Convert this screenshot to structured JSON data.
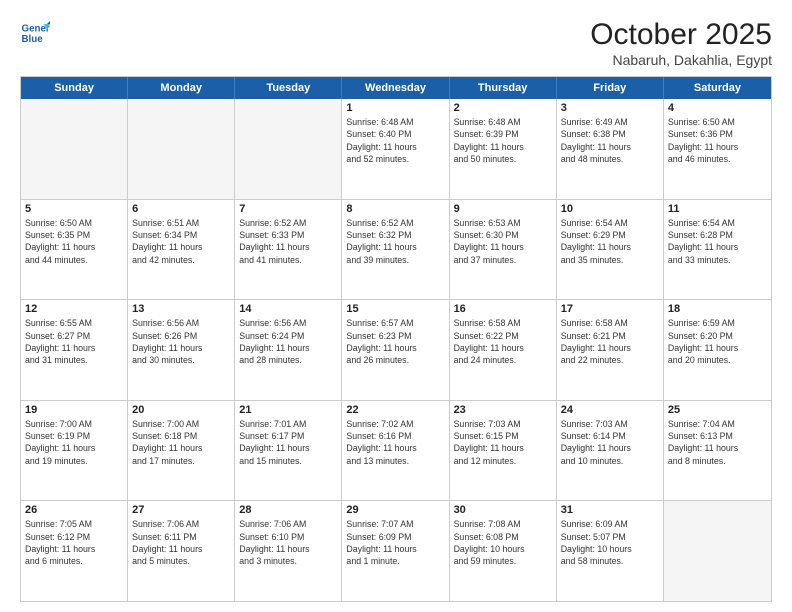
{
  "header": {
    "logo_line1": "General",
    "logo_line2": "Blue",
    "month": "October 2025",
    "location": "Nabaruh, Dakahlia, Egypt"
  },
  "weekdays": [
    "Sunday",
    "Monday",
    "Tuesday",
    "Wednesday",
    "Thursday",
    "Friday",
    "Saturday"
  ],
  "rows": [
    [
      {
        "day": "",
        "info": ""
      },
      {
        "day": "",
        "info": ""
      },
      {
        "day": "",
        "info": ""
      },
      {
        "day": "1",
        "info": "Sunrise: 6:48 AM\nSunset: 6:40 PM\nDaylight: 11 hours\nand 52 minutes."
      },
      {
        "day": "2",
        "info": "Sunrise: 6:48 AM\nSunset: 6:39 PM\nDaylight: 11 hours\nand 50 minutes."
      },
      {
        "day": "3",
        "info": "Sunrise: 6:49 AM\nSunset: 6:38 PM\nDaylight: 11 hours\nand 48 minutes."
      },
      {
        "day": "4",
        "info": "Sunrise: 6:50 AM\nSunset: 6:36 PM\nDaylight: 11 hours\nand 46 minutes."
      }
    ],
    [
      {
        "day": "5",
        "info": "Sunrise: 6:50 AM\nSunset: 6:35 PM\nDaylight: 11 hours\nand 44 minutes."
      },
      {
        "day": "6",
        "info": "Sunrise: 6:51 AM\nSunset: 6:34 PM\nDaylight: 11 hours\nand 42 minutes."
      },
      {
        "day": "7",
        "info": "Sunrise: 6:52 AM\nSunset: 6:33 PM\nDaylight: 11 hours\nand 41 minutes."
      },
      {
        "day": "8",
        "info": "Sunrise: 6:52 AM\nSunset: 6:32 PM\nDaylight: 11 hours\nand 39 minutes."
      },
      {
        "day": "9",
        "info": "Sunrise: 6:53 AM\nSunset: 6:30 PM\nDaylight: 11 hours\nand 37 minutes."
      },
      {
        "day": "10",
        "info": "Sunrise: 6:54 AM\nSunset: 6:29 PM\nDaylight: 11 hours\nand 35 minutes."
      },
      {
        "day": "11",
        "info": "Sunrise: 6:54 AM\nSunset: 6:28 PM\nDaylight: 11 hours\nand 33 minutes."
      }
    ],
    [
      {
        "day": "12",
        "info": "Sunrise: 6:55 AM\nSunset: 6:27 PM\nDaylight: 11 hours\nand 31 minutes."
      },
      {
        "day": "13",
        "info": "Sunrise: 6:56 AM\nSunset: 6:26 PM\nDaylight: 11 hours\nand 30 minutes."
      },
      {
        "day": "14",
        "info": "Sunrise: 6:56 AM\nSunset: 6:24 PM\nDaylight: 11 hours\nand 28 minutes."
      },
      {
        "day": "15",
        "info": "Sunrise: 6:57 AM\nSunset: 6:23 PM\nDaylight: 11 hours\nand 26 minutes."
      },
      {
        "day": "16",
        "info": "Sunrise: 6:58 AM\nSunset: 6:22 PM\nDaylight: 11 hours\nand 24 minutes."
      },
      {
        "day": "17",
        "info": "Sunrise: 6:58 AM\nSunset: 6:21 PM\nDaylight: 11 hours\nand 22 minutes."
      },
      {
        "day": "18",
        "info": "Sunrise: 6:59 AM\nSunset: 6:20 PM\nDaylight: 11 hours\nand 20 minutes."
      }
    ],
    [
      {
        "day": "19",
        "info": "Sunrise: 7:00 AM\nSunset: 6:19 PM\nDaylight: 11 hours\nand 19 minutes."
      },
      {
        "day": "20",
        "info": "Sunrise: 7:00 AM\nSunset: 6:18 PM\nDaylight: 11 hours\nand 17 minutes."
      },
      {
        "day": "21",
        "info": "Sunrise: 7:01 AM\nSunset: 6:17 PM\nDaylight: 11 hours\nand 15 minutes."
      },
      {
        "day": "22",
        "info": "Sunrise: 7:02 AM\nSunset: 6:16 PM\nDaylight: 11 hours\nand 13 minutes."
      },
      {
        "day": "23",
        "info": "Sunrise: 7:03 AM\nSunset: 6:15 PM\nDaylight: 11 hours\nand 12 minutes."
      },
      {
        "day": "24",
        "info": "Sunrise: 7:03 AM\nSunset: 6:14 PM\nDaylight: 11 hours\nand 10 minutes."
      },
      {
        "day": "25",
        "info": "Sunrise: 7:04 AM\nSunset: 6:13 PM\nDaylight: 11 hours\nand 8 minutes."
      }
    ],
    [
      {
        "day": "26",
        "info": "Sunrise: 7:05 AM\nSunset: 6:12 PM\nDaylight: 11 hours\nand 6 minutes."
      },
      {
        "day": "27",
        "info": "Sunrise: 7:06 AM\nSunset: 6:11 PM\nDaylight: 11 hours\nand 5 minutes."
      },
      {
        "day": "28",
        "info": "Sunrise: 7:06 AM\nSunset: 6:10 PM\nDaylight: 11 hours\nand 3 minutes."
      },
      {
        "day": "29",
        "info": "Sunrise: 7:07 AM\nSunset: 6:09 PM\nDaylight: 11 hours\nand 1 minute."
      },
      {
        "day": "30",
        "info": "Sunrise: 7:08 AM\nSunset: 6:08 PM\nDaylight: 10 hours\nand 59 minutes."
      },
      {
        "day": "31",
        "info": "Sunrise: 6:09 AM\nSunset: 5:07 PM\nDaylight: 10 hours\nand 58 minutes."
      },
      {
        "day": "",
        "info": ""
      }
    ]
  ]
}
